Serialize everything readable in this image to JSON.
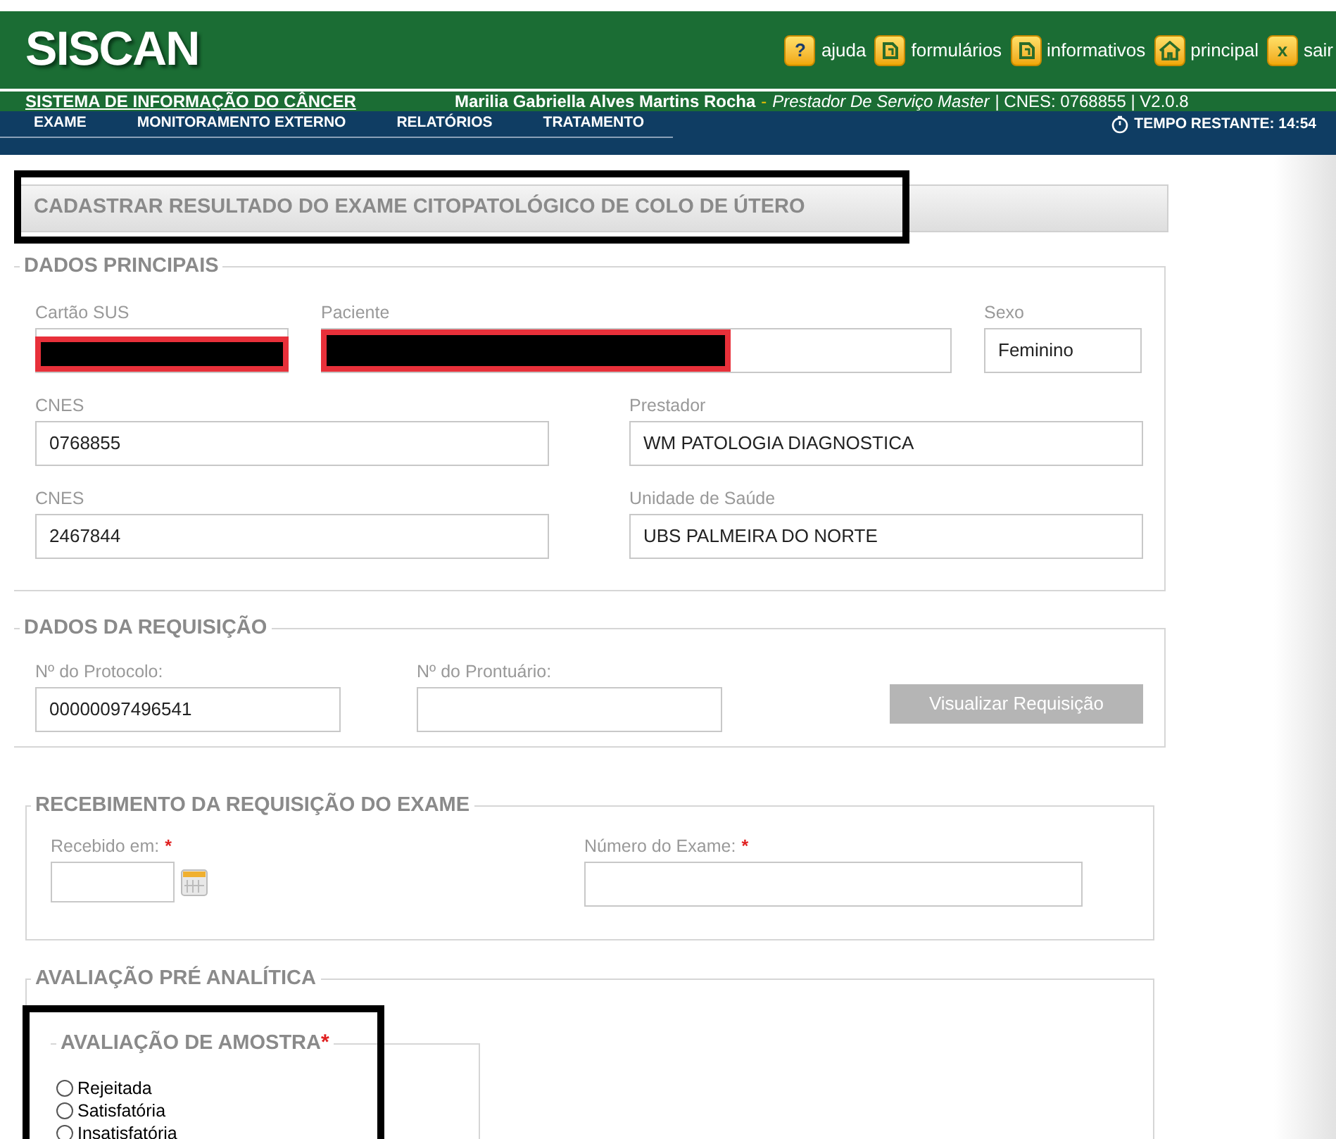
{
  "header": {
    "logo": "SISCAN",
    "links": [
      {
        "kind": "help",
        "glyph": "?",
        "label": "ajuda"
      },
      {
        "kind": "doc",
        "label": "formulários"
      },
      {
        "kind": "doc",
        "label": "informativos"
      },
      {
        "kind": "home",
        "label": "principal"
      },
      {
        "kind": "exit",
        "glyph": "x",
        "label": "sair"
      }
    ]
  },
  "info_bar": {
    "system": "SISTEMA DE INFORMAÇÃO DO CÂNCER",
    "user": "Marilia Gabriella Alves Martins Rocha",
    "separator": "-",
    "role": "Prestador De Serviço Master",
    "cnes": "| CNES: 0768855 | V2.0.8"
  },
  "nav": {
    "items": [
      {
        "label": "EXAME"
      },
      {
        "label": "MONITORAMENTO EXTERNO"
      },
      {
        "label": "RELATÓRIOS"
      },
      {
        "label": "TRATAMENTO"
      }
    ],
    "timer": "TEMPO RESTANTE: 14:54"
  },
  "page_title": "CADASTRAR RESULTADO DO EXAME CITOPATOLÓGICO DE COLO DE ÚTERO",
  "dados_principais": {
    "legend": "DADOS PRINCIPAIS",
    "cartao_sus": {
      "label": "Cartão SUS",
      "redacted": true
    },
    "paciente": {
      "label": "Paciente",
      "redacted": true
    },
    "sexo": {
      "label": "Sexo",
      "value": "Feminino"
    },
    "rows": [
      [
        {
          "label": "CNES",
          "value": "0768855"
        },
        {
          "label": "Prestador",
          "value": "WM PATOLOGIA DIAGNOSTICA"
        }
      ],
      [
        {
          "label": "CNES",
          "value": "2467844"
        },
        {
          "label": "Unidade de Saúde",
          "value": "UBS PALMEIRA DO NORTE"
        }
      ]
    ]
  },
  "dados_requisicao": {
    "legend": "DADOS DA REQUISIÇÃO",
    "protocolo": {
      "label": "Nº do Protocolo:",
      "value": "00000097496541"
    },
    "prontuario": {
      "label": "Nº do Prontuário:"
    },
    "button": "Visualizar Requisição"
  },
  "recebimento": {
    "legend": "RECEBIMENTO DA REQUISIÇÃO DO EXAME",
    "recebido": {
      "label": "Recebido em:",
      "required": "*"
    },
    "numero": {
      "label": "Número do Exame:",
      "required": "*"
    }
  },
  "avaliacao": {
    "legend": "AVALIAÇÃO PRÉ ANALÍTICA",
    "amostra": {
      "legend": "AVALIAÇÃO DE AMOSTRA",
      "required": "*",
      "options": [
        {
          "label": "Rejeitada",
          "selected": false
        },
        {
          "label": "Satisfatória",
          "selected": false
        },
        {
          "label": "Insatisfatória",
          "selected": false
        }
      ]
    }
  }
}
